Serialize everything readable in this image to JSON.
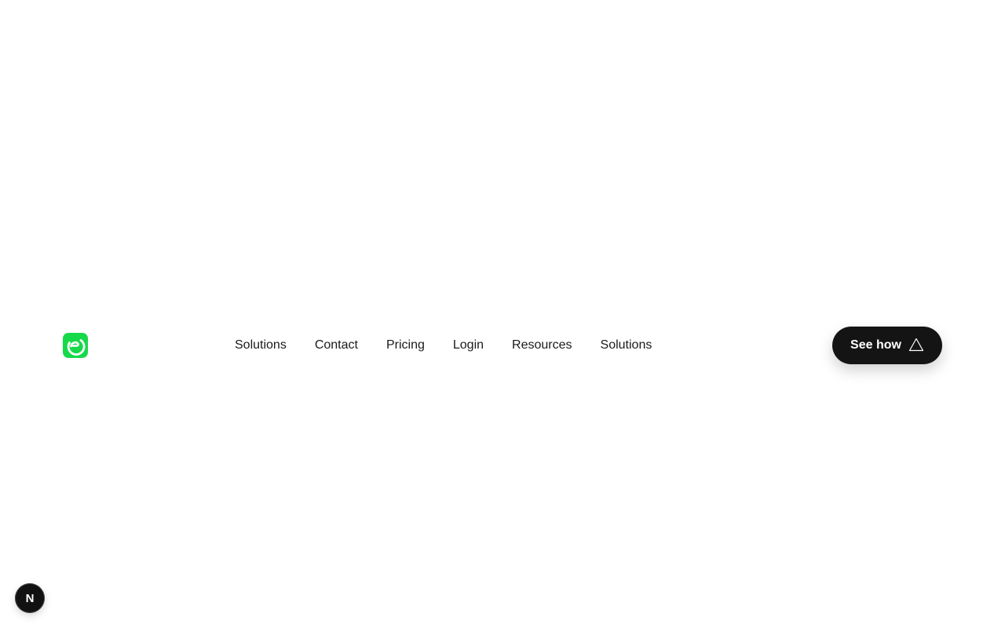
{
  "nav": {
    "logo": {
      "icon": "brand-logo-icon",
      "color": "#16d94a"
    },
    "links": [
      {
        "label": "Solutions"
      },
      {
        "label": "Contact"
      },
      {
        "label": "Pricing"
      },
      {
        "label": "Login"
      },
      {
        "label": "Resources"
      },
      {
        "label": "Solutions"
      }
    ],
    "cta": {
      "label": "See how",
      "icon": "triangle-outline-icon"
    }
  },
  "dev_badge": {
    "label": "N",
    "icon": "next-dev-indicator-icon"
  },
  "colors": {
    "background": "#ffffff",
    "text": "#1a1a1a",
    "cta_background": "#141414",
    "brand": "#16d94a"
  }
}
